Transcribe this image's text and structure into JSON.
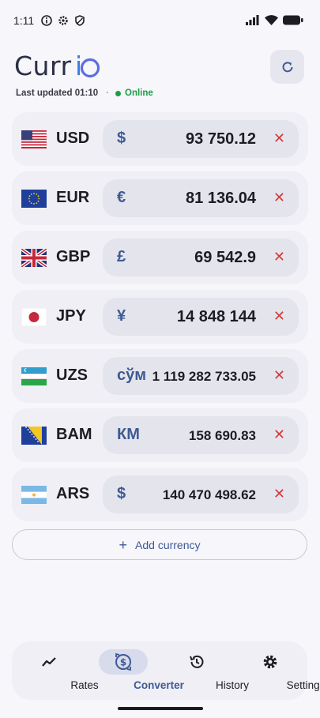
{
  "status_bar": {
    "time": "1:11"
  },
  "header": {
    "logo": "Currio",
    "last_updated": "Last updated 01:10",
    "separator": "·",
    "status": "Online"
  },
  "currencies": [
    {
      "code": "USD",
      "symbol": "$",
      "amount": "93 750.12",
      "remove": "✕"
    },
    {
      "code": "EUR",
      "symbol": "€",
      "amount": "81 136.04",
      "remove": "✕"
    },
    {
      "code": "GBP",
      "symbol": "£",
      "amount": "69 542.9",
      "remove": "✕"
    },
    {
      "code": "JPY",
      "symbol": "¥",
      "amount": "14 848 144",
      "remove": "✕"
    },
    {
      "code": "UZS",
      "symbol": "сўм",
      "amount": "1 119 282 733.05",
      "remove": "✕"
    },
    {
      "code": "BAM",
      "symbol": "КМ",
      "amount": "158 690.83",
      "remove": "✕"
    },
    {
      "code": "ARS",
      "symbol": "$",
      "amount": "140 470 498.62",
      "remove": "✕"
    }
  ],
  "add_currency": {
    "label": "Add currency"
  },
  "nav": [
    {
      "label": "Rates",
      "icon": "trending-icon"
    },
    {
      "label": "Converter",
      "icon": "converter-icon",
      "active": true
    },
    {
      "label": "History",
      "icon": "history-icon"
    },
    {
      "label": "Settings",
      "icon": "gear-icon"
    }
  ],
  "colors": {
    "accent": "#3e5a94",
    "online": "#1f9d45",
    "remove": "#d23a3a"
  }
}
